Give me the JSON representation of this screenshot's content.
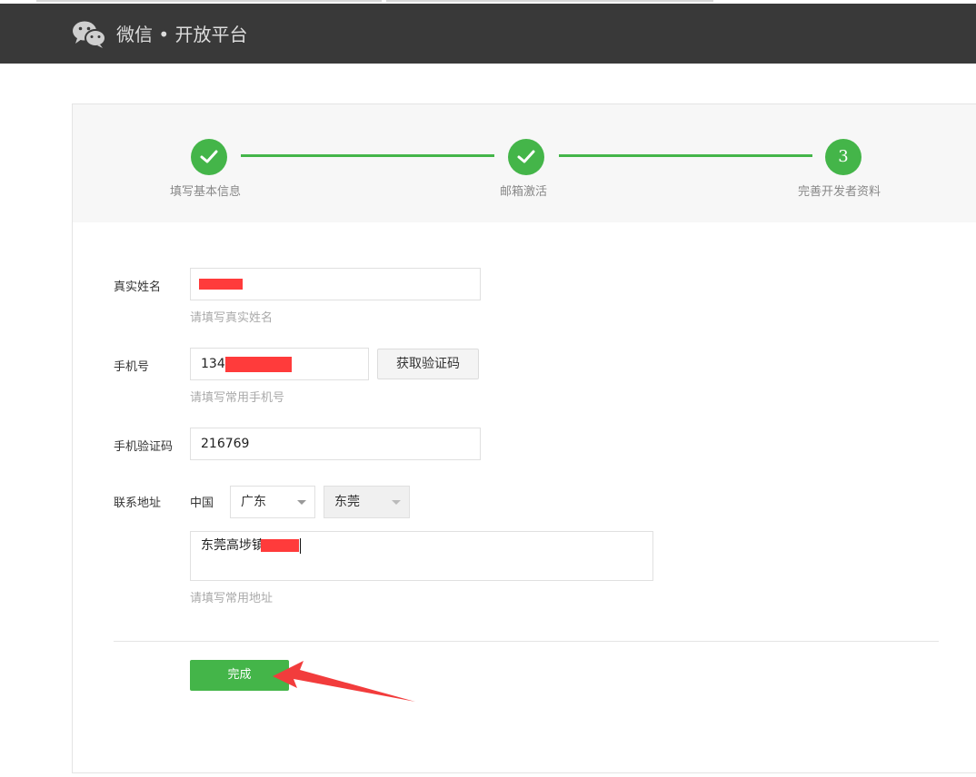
{
  "header": {
    "brand_title": "微信 • 开放平台",
    "logo_icon": "wechat-logo-icon"
  },
  "steps": [
    {
      "label": "填写基本信息",
      "status": "done",
      "icon": "check-icon"
    },
    {
      "label": "邮箱激活",
      "status": "done",
      "icon": "check-icon"
    },
    {
      "label": "完善开发者资料",
      "status": "current",
      "number": "3"
    }
  ],
  "form": {
    "name": {
      "label": "真实姓名",
      "value": "",
      "tip": "请填写真实姓名"
    },
    "phone": {
      "label": "手机号",
      "value_prefix": "134",
      "tip": "请填写常用手机号",
      "get_code_button": "获取验证码"
    },
    "sms_code": {
      "label": "手机验证码",
      "value": "216769"
    },
    "address": {
      "label": "联系地址",
      "country": "中国",
      "province": "广东",
      "city": "东莞",
      "detail_value": "东莞高埗镇",
      "tip": "请填写常用地址"
    },
    "submit_label": "完成"
  },
  "colors": {
    "accent": "#44b549",
    "header_bg": "#393939",
    "redaction": "#ff3b3b",
    "annotation_arrow": "#f23c3c"
  }
}
